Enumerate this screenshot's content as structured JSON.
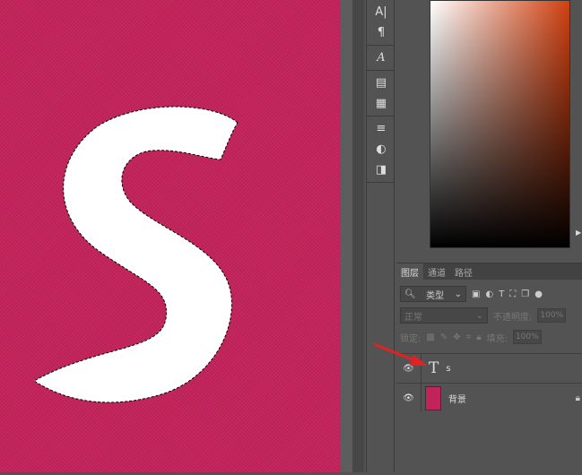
{
  "canvas": {
    "letter": "S",
    "background_color": "#c2235a"
  },
  "tools": [
    "character-icon",
    "paragraph-icon",
    "glyphs-icon",
    "libraries-icon",
    "notes-icon",
    "adjustments-icon",
    "styles-icon",
    "properties-icon"
  ],
  "layers_panel": {
    "tabs": [
      "图层",
      "通道",
      "路径"
    ],
    "active_tab": "图层",
    "filter": {
      "label": "类型"
    },
    "blend_mode": "正常",
    "opacity_label": "不透明度:",
    "opacity_value": "100%",
    "lock_label": "锁定:",
    "fill_label": "填充:",
    "fill_value": "100%",
    "layers": [
      {
        "name": "s",
        "type": "text"
      },
      {
        "name": "背景",
        "type": "image",
        "thumb_color": "#c2235a"
      }
    ]
  }
}
